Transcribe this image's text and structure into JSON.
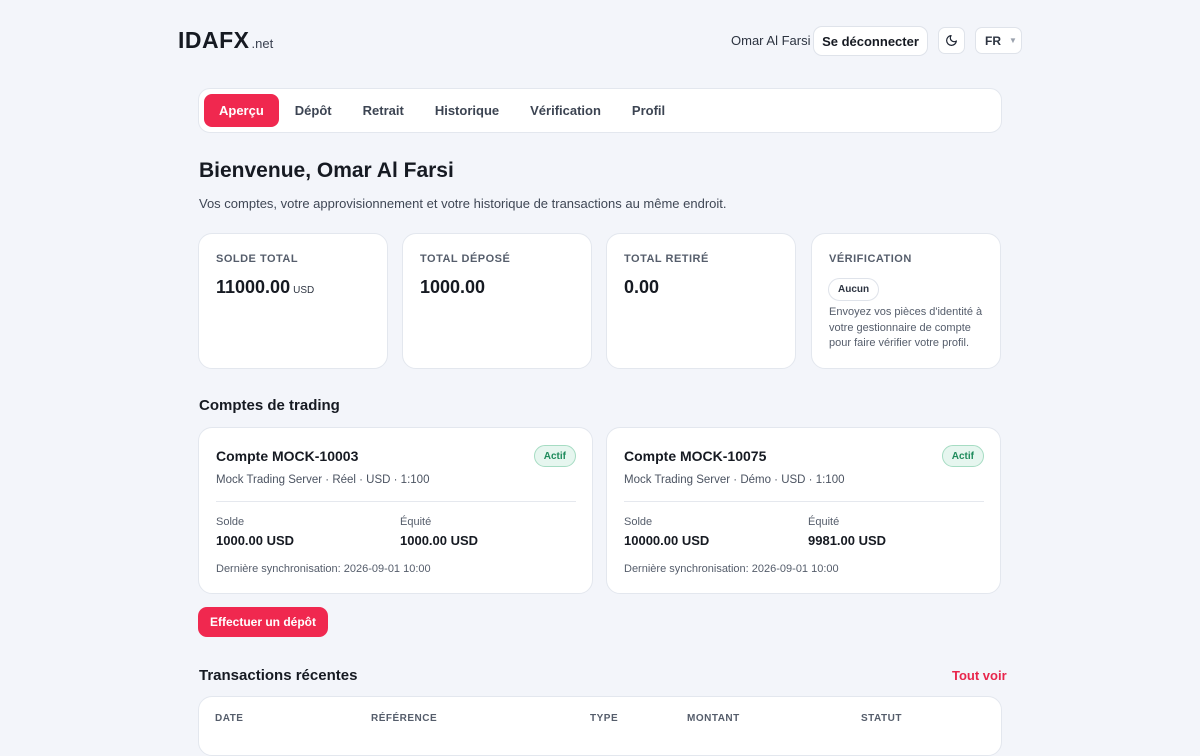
{
  "header": {
    "logo_main": "IDAFX",
    "logo_tld": ".net",
    "user_name": "Omar Al Farsi",
    "logout_label": "Se déconnecter",
    "theme_icon": "moon-icon",
    "language": "FR"
  },
  "tabs": [
    {
      "label": "Aperçu",
      "active": true
    },
    {
      "label": "Dépôt"
    },
    {
      "label": "Retrait"
    },
    {
      "label": "Historique"
    },
    {
      "label": "Vérification"
    },
    {
      "label": "Profil"
    }
  ],
  "welcome": {
    "title": "Bienvenue, Omar Al Farsi",
    "subtitle": "Vos comptes, votre approvisionnement et votre historique de transactions au même endroit."
  },
  "stats": {
    "total_balance": {
      "label": "SOLDE TOTAL",
      "value": "11000.00",
      "unit": "USD"
    },
    "total_deposited": {
      "label": "TOTAL DÉPOSÉ",
      "value": "1000.00"
    },
    "total_withdrawn": {
      "label": "TOTAL RETIRÉ",
      "value": "0.00"
    },
    "verification": {
      "label": "VÉRIFICATION",
      "badge": "Aucun",
      "text": "Envoyez vos pièces d'identité à votre gestionnaire de compte pour faire vérifier votre profil."
    }
  },
  "trading": {
    "title": "Comptes de trading",
    "accounts": [
      {
        "name": "Compte MOCK-10003",
        "status": "Actif",
        "meta": "Mock Trading Server · Réel · USD · 1:100",
        "balance_label": "Solde",
        "balance": "1000.00 USD",
        "equity_label": "Équité",
        "equity": "1000.00 USD",
        "sync": "Dernière synchronisation: 2026-09-01 10:00"
      },
      {
        "name": "Compte MOCK-10075",
        "status": "Actif",
        "meta": "Mock Trading Server · Démo · USD · 1:100",
        "balance_label": "Solde",
        "balance": "10000.00 USD",
        "equity_label": "Équité",
        "equity": "9981.00 USD",
        "sync": "Dernière synchronisation: 2026-09-01 10:00"
      }
    ]
  },
  "deposit_button": "Effectuer un dépôt",
  "transactions": {
    "title": "Transactions récentes",
    "see_all": "Tout voir",
    "columns": [
      "DATE",
      "RÉFÉRENCE",
      "TYPE",
      "MONTANT",
      "STATUT"
    ]
  },
  "colors": {
    "accent": "#f0284f",
    "background": "#f3f5fa",
    "success": "#1f8b5c"
  }
}
